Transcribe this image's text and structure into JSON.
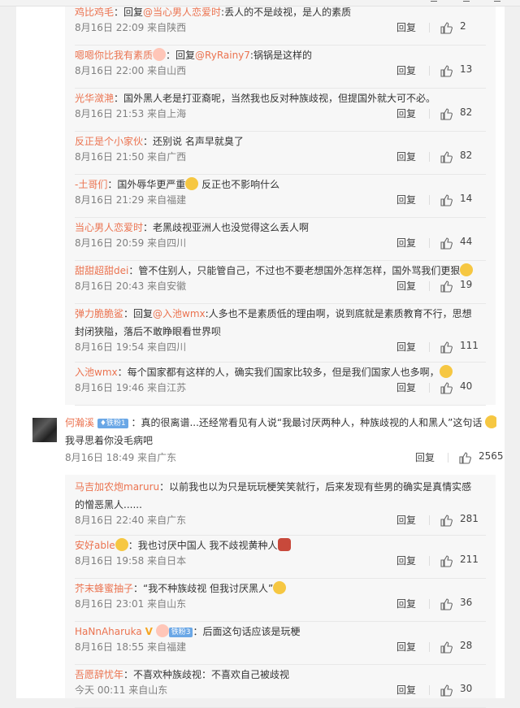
{
  "replies_a": [
    {
      "user": "鸡比鸡毛",
      "segments": [
        {
          "t": "：回复"
        },
        {
          "m": "@当心男人恋爱时"
        },
        {
          "t": ":丢人的不是歧视，是人的素质"
        }
      ],
      "date": "8月16日 22:09",
      "loc": "来自陕西",
      "likes": "2"
    },
    {
      "user": "嗯嗯你比我有素质",
      "segments": [
        {
          "t": "：回复"
        },
        {
          "m": "@RyRainy7"
        },
        {
          "t": ":锅锅是这样的"
        }
      ],
      "date": "8月16日 22:00",
      "loc": "来自山西",
      "likes": "13",
      "user_emoji": "pink"
    },
    {
      "user": "光华潋滟",
      "segments": [
        {
          "t": "：国外黑人老是打亚裔呢，当然我也反对种族歧视，但提国外就大可不必。"
        }
      ],
      "date": "8月16日 21:53",
      "loc": "来自上海",
      "likes": "82"
    },
    {
      "user": "反正是个小家伙",
      "segments": [
        {
          "t": "：还别说 名声早就臭了"
        }
      ],
      "date": "8月16日 21:50",
      "loc": "来自广西",
      "likes": "82"
    },
    {
      "user": "-土哥们",
      "segments": [
        {
          "t": "：国外辱华更严重"
        },
        {
          "e": "yellow"
        },
        {
          "t": " 反正也不影响什么"
        }
      ],
      "date": "8月16日 21:29",
      "loc": "来自福建",
      "likes": "14"
    },
    {
      "user": "当心男人恋爱时",
      "segments": [
        {
          "t": "：老黑歧视亚洲人也没觉得这么丢人啊"
        }
      ],
      "date": "8月16日 20:59",
      "loc": "来自四川",
      "likes": "44"
    },
    {
      "user": "甜甜超甜dei",
      "segments": [
        {
          "t": "：管不住别人，只能管自己，不过也不要老想国外怎样怎样，国外骂我们更狠"
        },
        {
          "e": "yellow"
        }
      ],
      "date": "8月16日 20:43",
      "loc": "来自安徽",
      "likes": "19"
    },
    {
      "user": "弹力脆脆鲨",
      "segments": [
        {
          "t": "：回复"
        },
        {
          "m": "@入池wmx"
        },
        {
          "t": ":人多也不是素质低的理由啊，说到底就是素质教育不行，思想"
        }
      ],
      "line2": "封闭狭隘，落后不敢睁眼看世界呗",
      "date": "8月16日 19:54",
      "loc": "来自四川",
      "likes": "111"
    },
    {
      "user": "入池wmx",
      "segments": [
        {
          "t": "：每个国家都有这样的人，确实我们国家比较多，但是我们国家人也多啊，"
        },
        {
          "e": "yellow"
        }
      ],
      "date": "8月16日 19:46",
      "loc": "来自江苏",
      "likes": "40"
    }
  ],
  "main_comment": {
    "user": "何瀚溪",
    "fan_badge": "铁粉1",
    "text": "：真的很离谱...还经常看见有人说“我最讨厌两种人，种族歧视的人和黑人”这句话",
    "line2": "我寻思着你没毛病吧",
    "date": "8月16日 18:49",
    "loc": "来自广东",
    "likes": "2565"
  },
  "replies_b": [
    {
      "user": "马吉加农炮maruru",
      "segments": [
        {
          "t": "：以前我也以为只是玩玩梗笑笑就行，后来发现有些男的确实是真情实感"
        }
      ],
      "line2": "的憎恶黑人......",
      "date": "8月16日 22:40",
      "loc": "来自广东",
      "likes": "281"
    },
    {
      "user": "安好able",
      "segments": [
        {
          "t": "：我也讨厌中国人 我不歧视黄种人"
        },
        {
          "e": "red"
        }
      ],
      "date": "8月16日 19:58",
      "loc": "来自日本",
      "likes": "211",
      "user_emoji": "yellow"
    },
    {
      "user": "芥末蜂蜜抽子",
      "segments": [
        {
          "t": "：“我不种族歧视 但我讨厌黑人”"
        },
        {
          "e": "yellow"
        }
      ],
      "date": "8月16日 23:01",
      "loc": "来自山东",
      "likes": "36"
    },
    {
      "user": "HaNnAharuka",
      "segments": [
        {
          "t": "：后面这句话应该是玩梗"
        }
      ],
      "date": "8月16日 18:55",
      "loc": "来自福建",
      "likes": "28",
      "vip": "V",
      "fan_badge": "铁粉3"
    },
    {
      "user": "吾愿辞忧年",
      "segments": [
        {
          "t": "：不喜欢种族歧视：不喜欢自己被歧视"
        }
      ],
      "date": "今天 00:11",
      "loc": "来自山东",
      "likes": "30"
    }
  ],
  "labels": {
    "reply": "回复"
  },
  "colors": {
    "username": "#eb7350",
    "meta": "#808080",
    "reply_bg": "#f7f7f7"
  }
}
